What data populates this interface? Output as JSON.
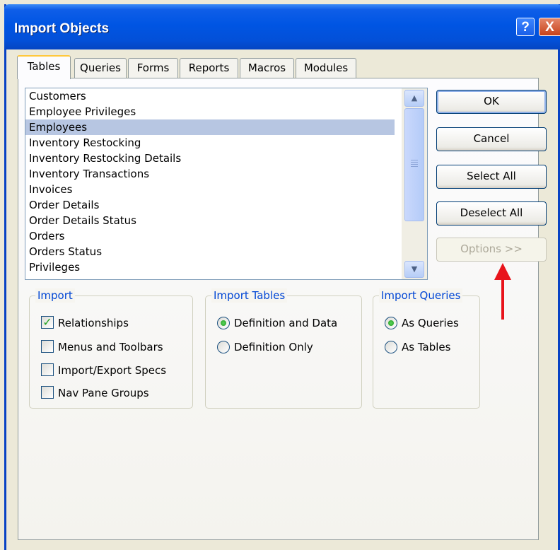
{
  "window": {
    "title": "Import Objects"
  },
  "titlebar": {
    "help_label": "?",
    "close_label": "X"
  },
  "tabs": [
    "Tables",
    "Queries",
    "Forms",
    "Reports",
    "Macros",
    "Modules"
  ],
  "list": {
    "items": [
      "Customers",
      "Employee Privileges",
      "Employees",
      "Inventory Restocking",
      "Inventory Restocking Details",
      "Inventory Transactions",
      "Invoices",
      "Order Details",
      "Order Details Status",
      "Orders",
      "Orders Status",
      "Privileges"
    ],
    "selected": "Employees"
  },
  "buttons": {
    "ok": "OK",
    "cancel": "Cancel",
    "select_all": "Select All",
    "deselect_all": "Deselect All",
    "options": "Options >>"
  },
  "import_group": {
    "title": "Import",
    "options": [
      {
        "label": "Relationships",
        "checked": true
      },
      {
        "label": "Menus and Toolbars",
        "checked": false
      },
      {
        "label": "Import/Export Specs",
        "checked": false
      },
      {
        "label": "Nav Pane Groups",
        "checked": false
      }
    ]
  },
  "import_tables_group": {
    "title": "Import Tables",
    "options": [
      {
        "label": "Definition and Data",
        "selected": true
      },
      {
        "label": "Definition Only",
        "selected": false
      }
    ]
  },
  "import_queries_group": {
    "title": "Import Queries",
    "options": [
      {
        "label": "As Queries",
        "selected": true
      },
      {
        "label": "As Tables",
        "selected": false
      }
    ]
  },
  "colors": {
    "titlebar": "#0055e3",
    "selection": "#b7c6e2",
    "group_title": "#0046d5",
    "annotation_arrow": "#e8141b"
  }
}
